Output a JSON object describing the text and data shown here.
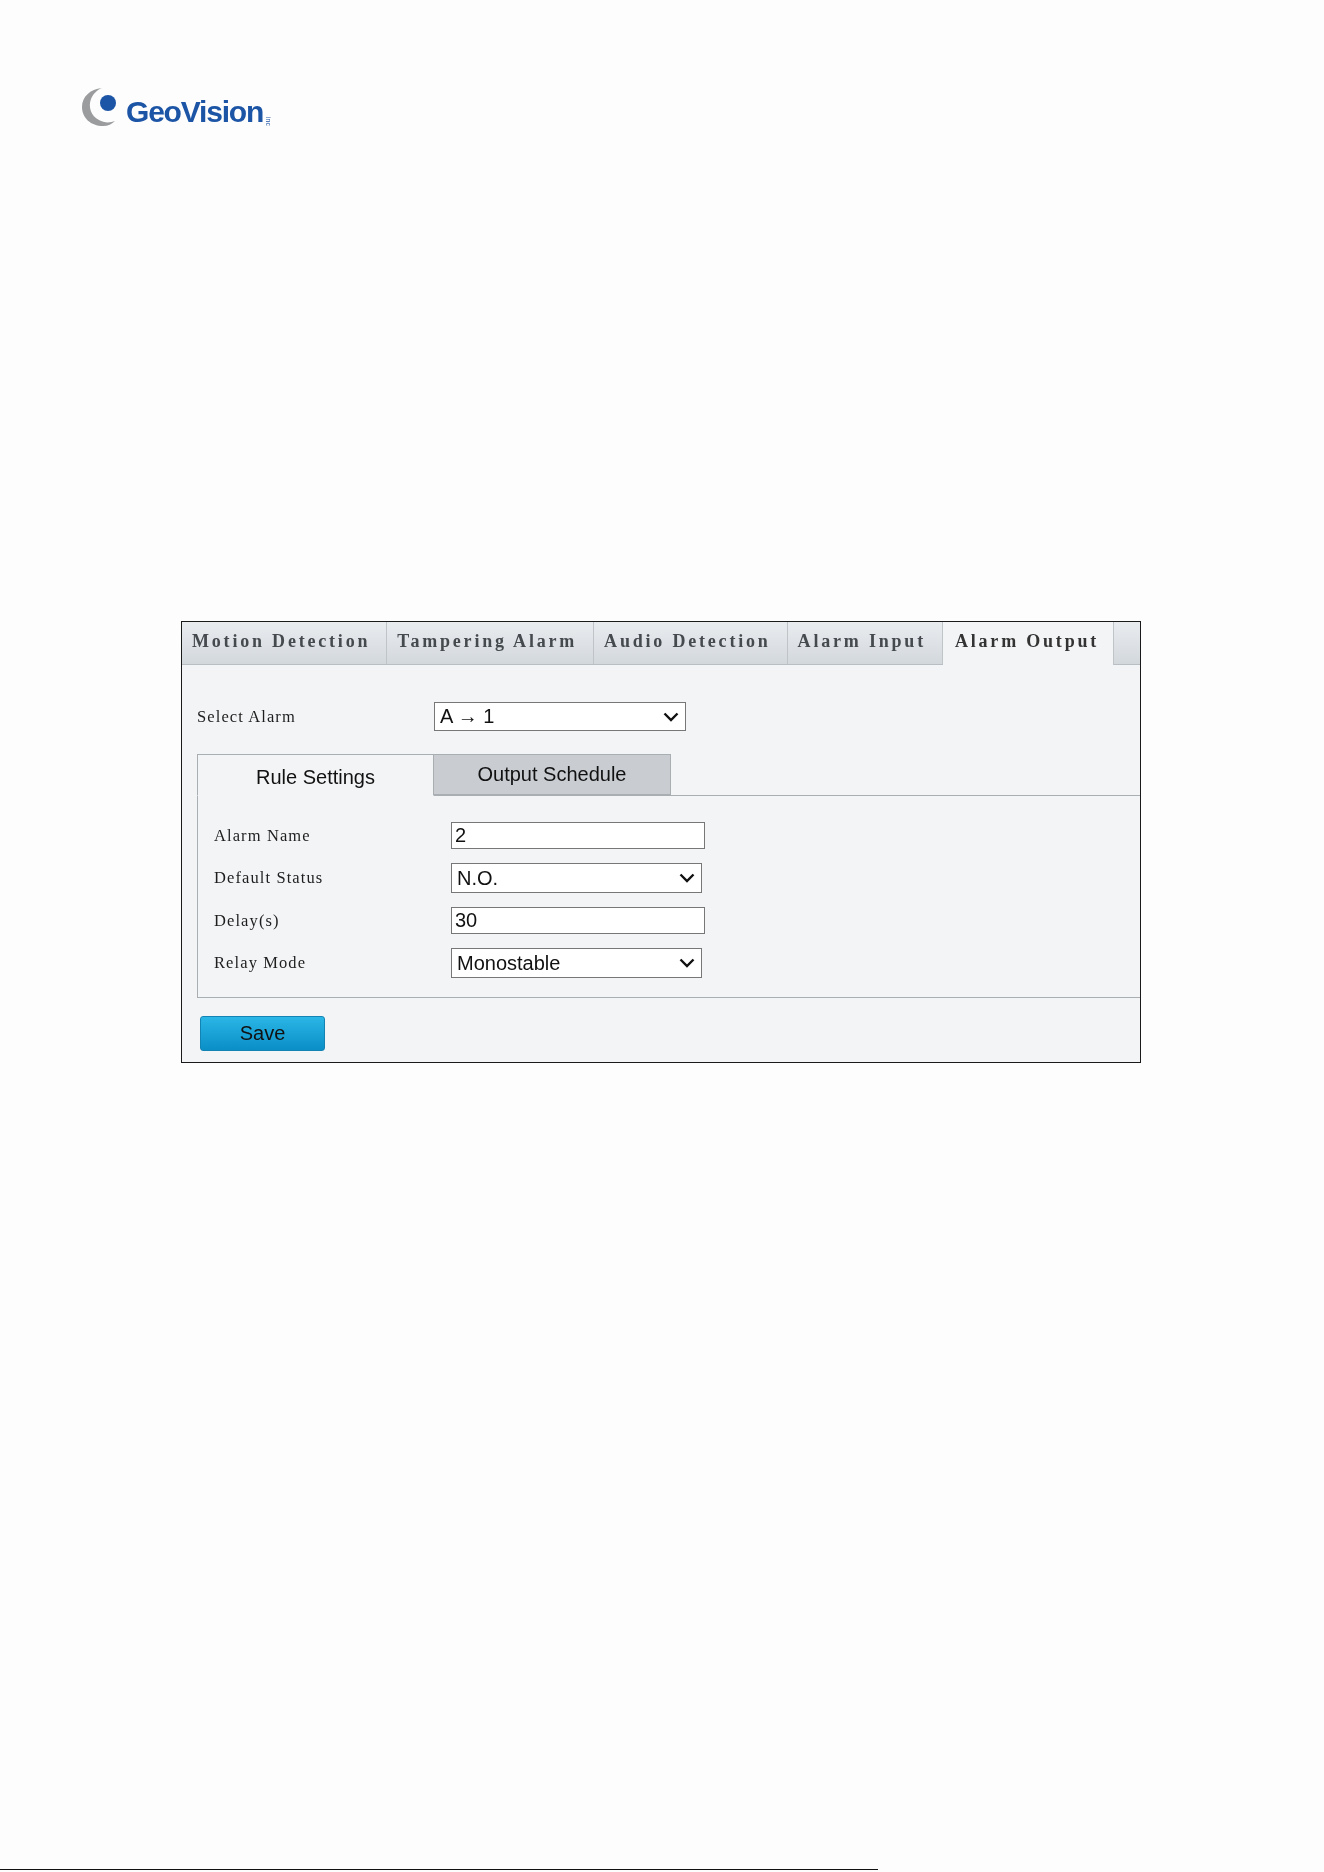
{
  "header": {
    "logo": {
      "wordmark": "GeoVision",
      "suffix": "inc"
    }
  },
  "panel": {
    "tabs": [
      {
        "label": "Motion Detection",
        "selected": false
      },
      {
        "label": "Tampering Alarm",
        "selected": false
      },
      {
        "label": "Audio Detection",
        "selected": false
      },
      {
        "label": "Alarm Input",
        "selected": false
      },
      {
        "label": "Alarm Output",
        "selected": true
      }
    ],
    "select_alarm": {
      "label": "Select Alarm",
      "value": "A → 1"
    },
    "subtabs": [
      {
        "label": "Rule Settings",
        "selected": true
      },
      {
        "label": "Output Schedule",
        "selected": false
      }
    ],
    "fields": [
      {
        "label": "Alarm Name",
        "kind": "text",
        "value": "2"
      },
      {
        "label": "Default Status",
        "kind": "dropdown",
        "value": "N.O."
      },
      {
        "label": "Delay(s)",
        "kind": "text",
        "value": "30"
      },
      {
        "label": "Relay Mode",
        "kind": "dropdown",
        "value": "Monostable"
      }
    ],
    "save_button": "Save"
  }
}
